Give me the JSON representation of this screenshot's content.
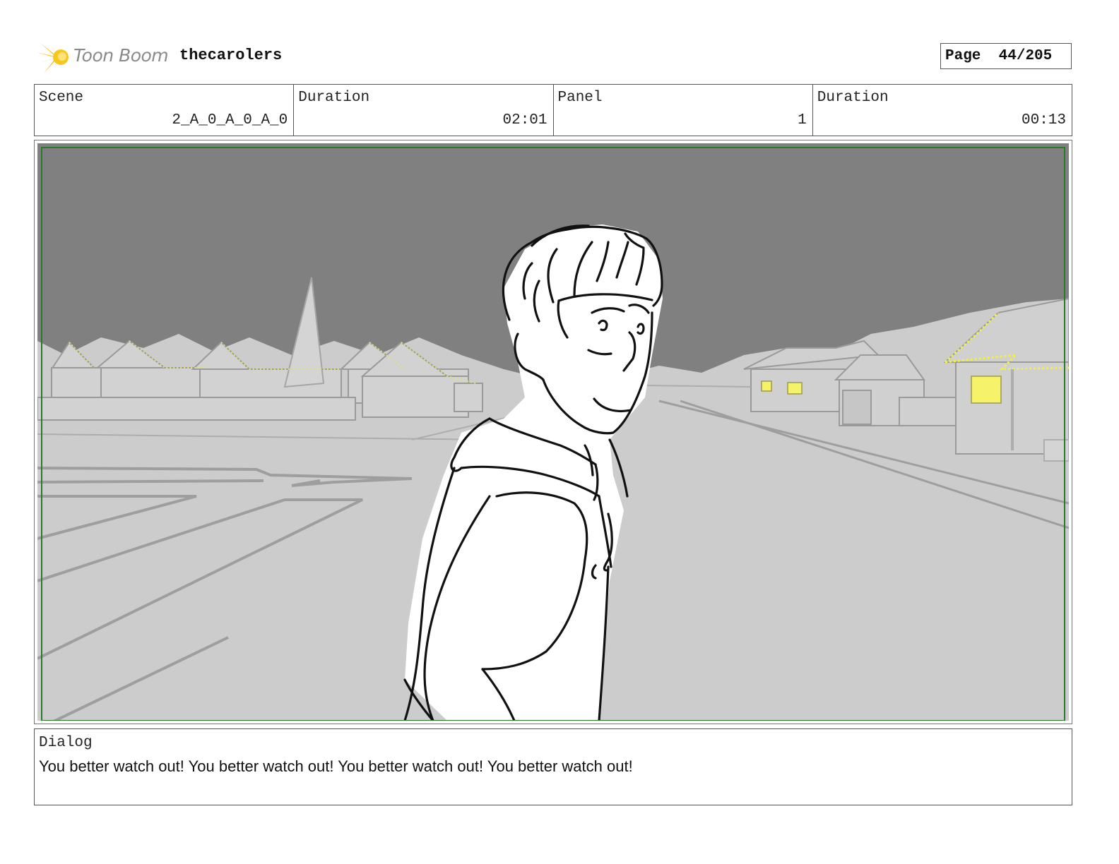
{
  "header": {
    "logo_text": "Toon Boom",
    "project_title": "thecarolers",
    "page_label": "Page",
    "page_value": "44/205"
  },
  "info": [
    {
      "label": "Scene",
      "value": "2_A_0_A_0_A_0"
    },
    {
      "label": "Duration",
      "value": "02:01"
    },
    {
      "label": "Panel",
      "value": "1"
    },
    {
      "label": "Duration",
      "value": "00:13"
    }
  ],
  "panel": {
    "sky_color": "#808080",
    "ground_color": "#cccccc",
    "safe_frame_color": "#2a7a2a",
    "light_color": "#f6f36a"
  },
  "dialog": {
    "label": "Dialog",
    "text": "You better watch out! You better watch out! You better watch out! You better watch out!"
  }
}
